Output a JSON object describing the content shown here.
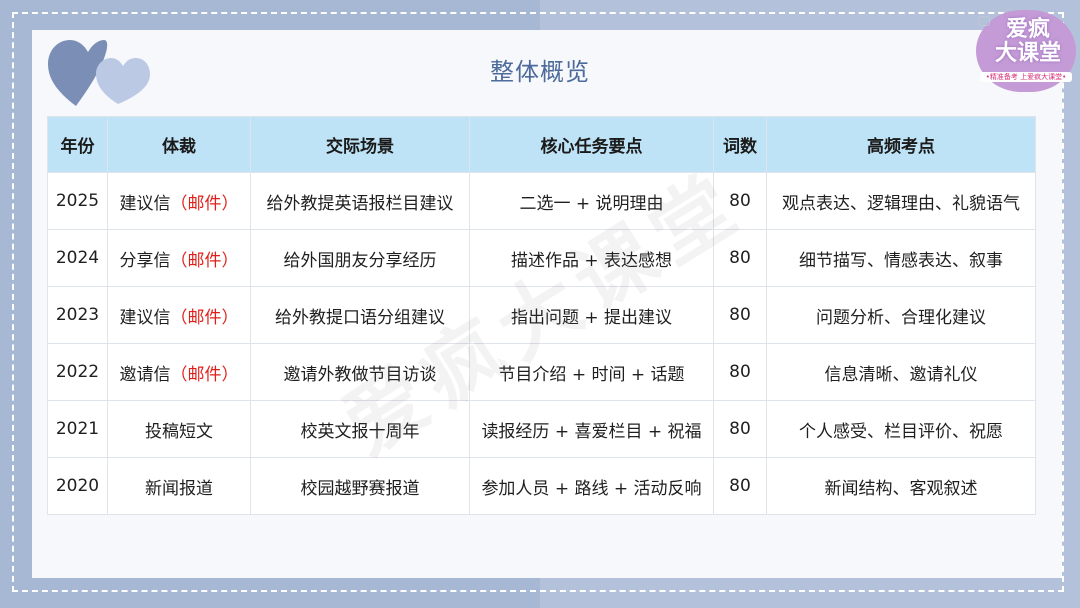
{
  "title": "整体概览",
  "logo": {
    "line1": "爱疯",
    "line2": "大课堂",
    "slogan": "•精准备考 上爱疯大课堂•"
  },
  "watermark": "爱疯大课堂",
  "table": {
    "headers": [
      "年份",
      "体裁",
      "交际场景",
      "核心任务要点",
      "词数",
      "高频考点"
    ],
    "rows": [
      {
        "year": "2025",
        "genre": "建议信",
        "genre_note": "（邮件）",
        "scene": "给外教提英语报栏目建议",
        "tasks": "二选一 + 说明理由",
        "words": "80",
        "focus": "观点表达、逻辑理由、礼貌语气"
      },
      {
        "year": "2024",
        "genre": "分享信",
        "genre_note": "（邮件）",
        "scene": "给外国朋友分享经历",
        "tasks": "描述作品 + 表达感想",
        "words": "80",
        "focus": "细节描写、情感表达、叙事"
      },
      {
        "year": "2023",
        "genre": "建议信",
        "genre_note": "（邮件）",
        "scene": "给外教提口语分组建议",
        "tasks": "指出问题 + 提出建议",
        "words": "80",
        "focus": "问题分析、合理化建议"
      },
      {
        "year": "2022",
        "genre": "邀请信",
        "genre_note": "（邮件）",
        "scene": "邀请外教做节目访谈",
        "tasks": "节目介绍 + 时间 + 话题",
        "words": "80",
        "focus": "信息清晰、邀请礼仪"
      },
      {
        "year": "2021",
        "genre": "投稿短文",
        "genre_note": "",
        "scene": "校英文报十周年",
        "tasks": "读报经历 + 喜爱栏目 + 祝福",
        "words": "80",
        "focus": "个人感受、栏目评价、祝愿"
      },
      {
        "year": "2020",
        "genre": "新闻报道",
        "genre_note": "",
        "scene": "校园越野赛报道",
        "tasks": "参加人员 + 路线 + 活动反响",
        "words": "80",
        "focus": "新闻结构、客观叙述"
      }
    ]
  },
  "colors": {
    "background": "#a6b8d4",
    "card": "#f6f8fc",
    "header": "#bfe3f6",
    "title": "#4d6a9a",
    "mail_note": "#e0201a"
  },
  "icons": [
    "heart-icon",
    "heart-icon",
    "camera-icon"
  ]
}
